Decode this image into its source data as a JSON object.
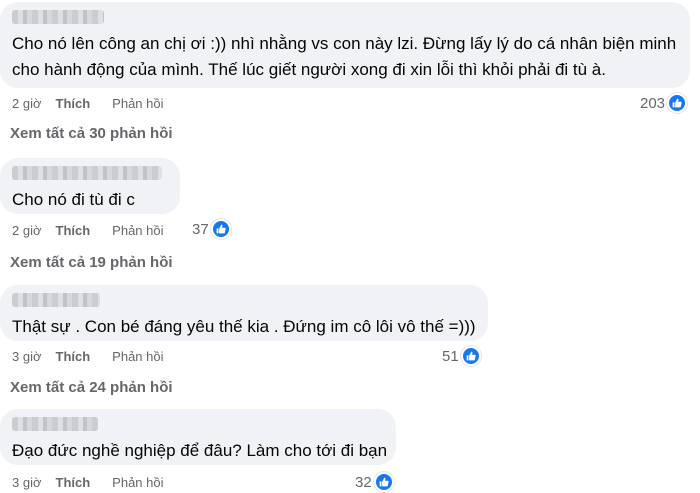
{
  "comments": [
    {
      "text_lines": [
        "Cho nó lên công an chị ơi :)) nhì nhằng vs con này lzi. Đừng lấy lý do cá nhân biện minh",
        "cho hành động của mình. Thế lúc giết người xong đi xin lỗi thì khỏi phải đi tù à."
      ],
      "time": "2 giờ",
      "like_label": "Thích",
      "reply_label": "Phản hồi",
      "reaction_count": "203",
      "reaction_icon": "like-icon",
      "view_replies": "Xem tất cả 30 phản hồi"
    },
    {
      "text_lines": [
        "Cho nó đi tù đi c"
      ],
      "time": "2 giờ",
      "like_label": "Thích",
      "reply_label": "Phản hồi",
      "reaction_count": "37",
      "reaction_icon": "like-icon",
      "view_replies": "Xem tất cả 19 phản hồi"
    },
    {
      "text_lines": [
        "Thật sự . Con bé đáng yêu thế kia . Đứng im cô lôi vô thế =)))"
      ],
      "time": "3 giờ",
      "like_label": "Thích",
      "reply_label": "Phản hồi",
      "reaction_count": "51",
      "reaction_icon": "like-icon",
      "view_replies": "Xem tất cả 24 phản hồi"
    },
    {
      "text_lines": [
        "Đạo đức nghề nghiệp để đâu? Làm cho tới đi bạn"
      ],
      "time": "3 giờ",
      "like_label": "Thích",
      "reply_label": "Phản hồi",
      "reaction_count": "32",
      "reaction_icon": "like-icon"
    }
  ],
  "colors": {
    "bubble": "#f0f2f5",
    "secondary_text": "#65676b",
    "like_blue": "#1877f2"
  }
}
